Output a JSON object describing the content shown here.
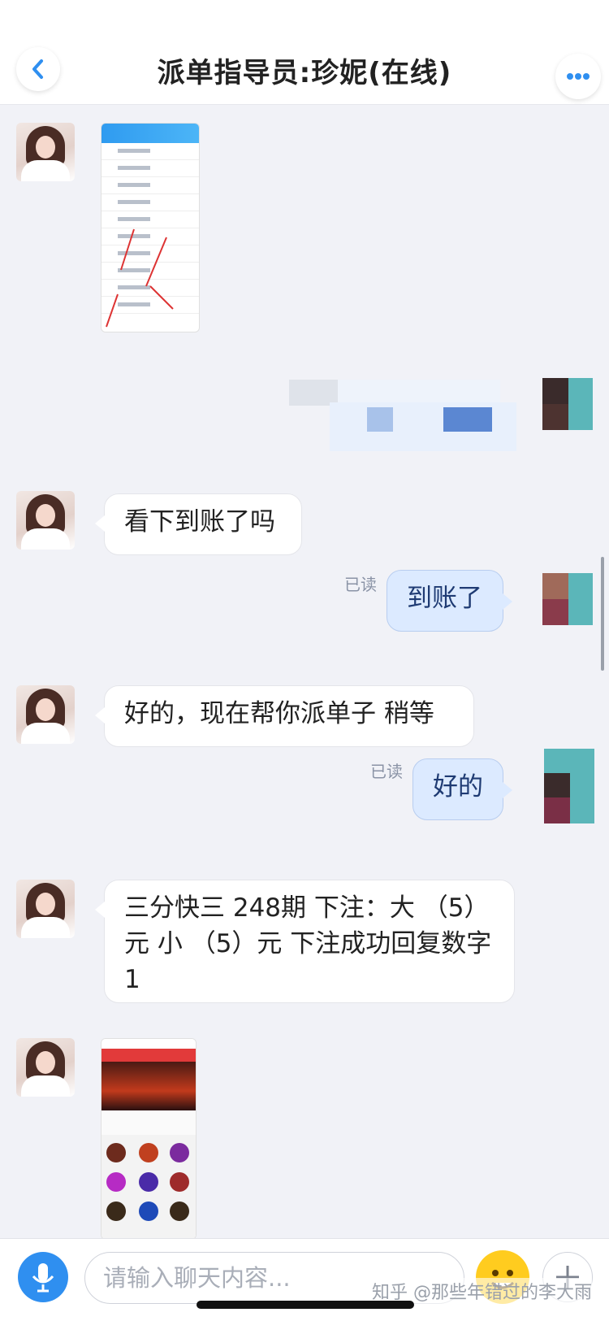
{
  "header": {
    "title": "派单指导员:珍妮(在线)",
    "back_icon": "chevron-left-icon",
    "more_icon": "ellipsis-icon"
  },
  "messages": [
    {
      "side": "in",
      "type": "image",
      "caption": ""
    },
    {
      "side": "out",
      "type": "image-redacted"
    },
    {
      "side": "in",
      "type": "text",
      "text": "看下到账了吗"
    },
    {
      "side": "out",
      "type": "text",
      "text": "到账了",
      "status": "已读"
    },
    {
      "side": "in",
      "type": "text",
      "text": "好的，现在帮你派单子  稍等"
    },
    {
      "side": "out",
      "type": "text",
      "text": "好的",
      "status": "已读"
    },
    {
      "side": "in",
      "type": "text",
      "text": " 三分快三  248期  下注：大 （5）元  小 （5）元    下注成功回复数字 1"
    },
    {
      "side": "in",
      "type": "image"
    }
  ],
  "footer": {
    "input_placeholder": "请输入聊天内容...",
    "mic_icon": "microphone-icon",
    "emoji_icon": "emoji-icon",
    "plus_icon": "plus-icon",
    "watermark": "知乎 @那些年错过的李大雨"
  },
  "colors": {
    "accent": "#2f8ff0",
    "outgoing_bubble": "#dceaff",
    "background": "#f1f2f7"
  }
}
